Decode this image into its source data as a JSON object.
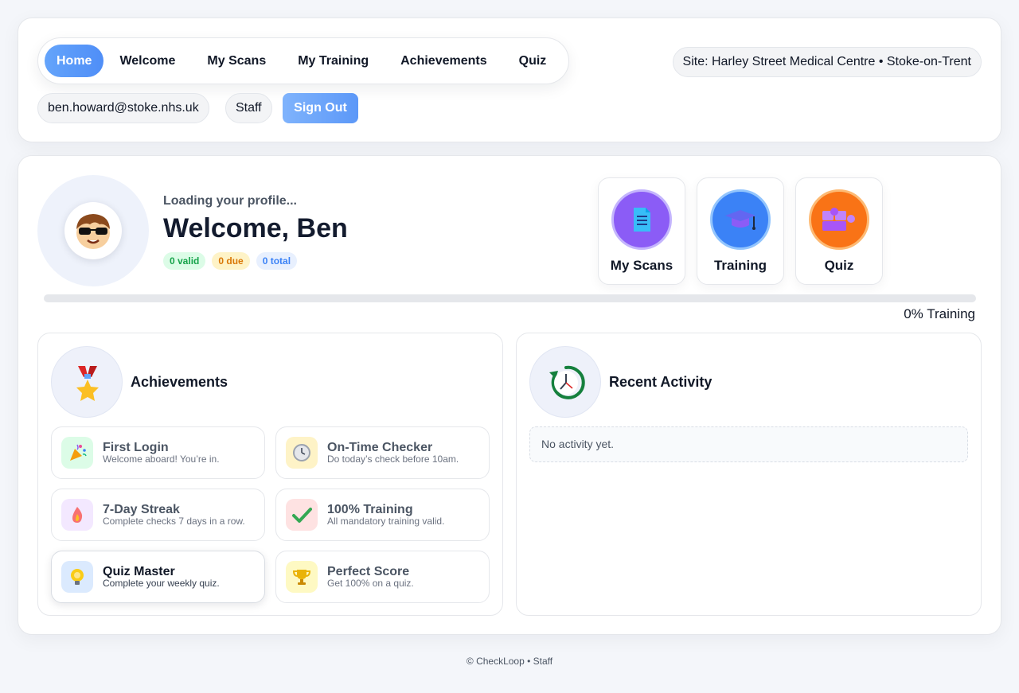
{
  "nav": {
    "items": [
      {
        "label": "Home",
        "active": true
      },
      {
        "label": "Welcome"
      },
      {
        "label": "My Scans"
      },
      {
        "label": "My Training"
      },
      {
        "label": "Achievements"
      },
      {
        "label": "Quiz"
      }
    ]
  },
  "site_label": "Site: Harley Street Medical Centre • Stoke-on-Trent",
  "user": {
    "email": "ben.howard@stoke.nhs.uk",
    "role": "Staff",
    "sign_out_label": "Sign Out"
  },
  "profile": {
    "loading_text": "Loading your profile...",
    "welcome_text": "Welcome, Ben",
    "badges": {
      "valid": "0 valid",
      "due": "0 due",
      "total": "0 total"
    },
    "avatar_icon": "cartoon-face-sunglasses-icon"
  },
  "quick_links": [
    {
      "label": "My Scans",
      "icon": "document-icon",
      "color": "#8b5cf6"
    },
    {
      "label": "Training",
      "icon": "graduation-cap-icon",
      "color": "#3b82f6"
    },
    {
      "label": "Quiz",
      "icon": "puzzle-icon",
      "color": "#f97316"
    }
  ],
  "training_progress": {
    "percent": 0,
    "label": "0% Training"
  },
  "achievements": {
    "title": "Achievements",
    "icon": "medal-icon",
    "items": [
      {
        "title": "First Login",
        "desc": "Welcome aboard! You’re in.",
        "icon": "party-popper-icon",
        "bg": "#dcfce7",
        "unlocked": false
      },
      {
        "title": "On-Time Checker",
        "desc": "Do today’s check before 10am.",
        "icon": "clock-icon",
        "bg": "#fef3c7",
        "unlocked": false
      },
      {
        "title": "7-Day Streak",
        "desc": "Complete checks 7 days in a row.",
        "icon": "flame-icon",
        "bg": "#f3e8ff",
        "unlocked": false
      },
      {
        "title": "100% Training",
        "desc": "All mandatory training valid.",
        "icon": "checkmark-icon",
        "bg": "#fee2e2",
        "unlocked": false
      },
      {
        "title": "Quiz Master",
        "desc": "Complete your weekly quiz.",
        "icon": "lightbulb-icon",
        "bg": "#dbeafe",
        "unlocked": true
      },
      {
        "title": "Perfect Score",
        "desc": "Get 100% on a quiz.",
        "icon": "trophy-icon",
        "bg": "#fef9c3",
        "unlocked": false
      }
    ]
  },
  "activity": {
    "title": "Recent Activity",
    "icon": "history-clock-icon",
    "empty_text": "No activity yet."
  },
  "footer": "© CheckLoop • Staff"
}
